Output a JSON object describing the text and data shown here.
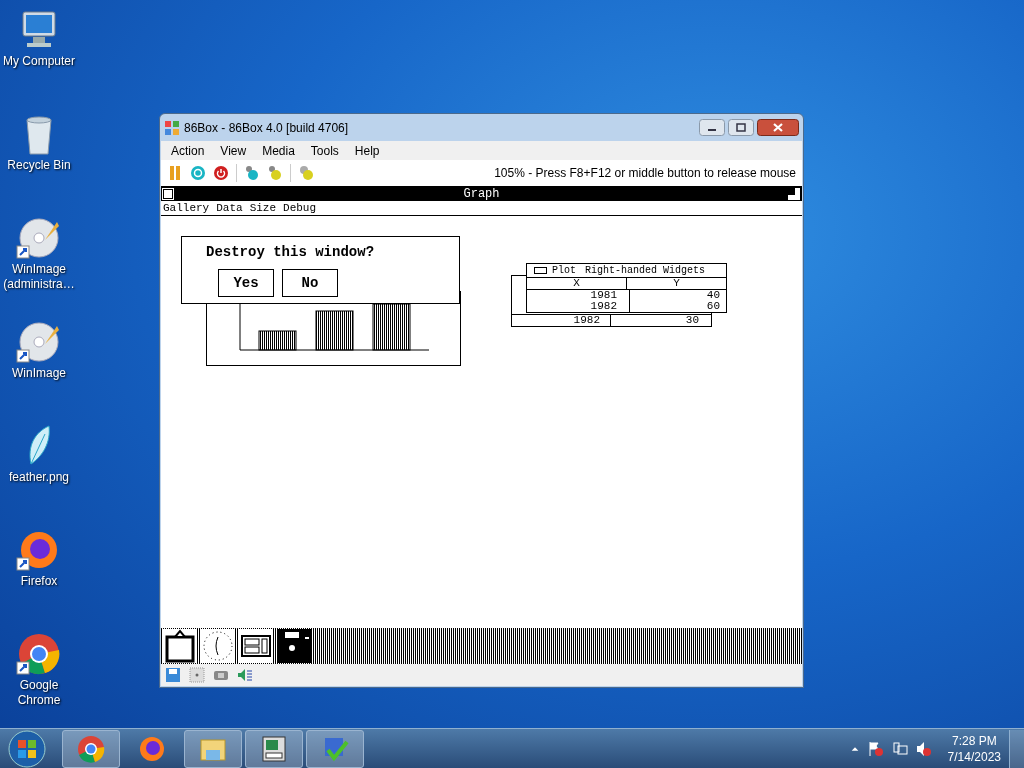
{
  "desktop_icons": [
    {
      "label": "My Computer",
      "kind": "computer"
    },
    {
      "label": "Recycle Bin",
      "kind": "recycle"
    },
    {
      "label": "WinImage (administra…",
      "kind": "disc-shortcut"
    },
    {
      "label": "WinImage",
      "kind": "disc-shortcut"
    },
    {
      "label": "feather.png",
      "kind": "feather"
    },
    {
      "label": "Firefox",
      "kind": "firefox"
    },
    {
      "label": "Google Chrome",
      "kind": "chrome"
    }
  ],
  "window": {
    "title": "86Box - 86Box 4.0 [build 4706]",
    "menu": [
      "Action",
      "View",
      "Media",
      "Tools",
      "Help"
    ],
    "status_text": "105% - Press F8+F12 or middle button to release mouse",
    "guest": {
      "title": "Graph",
      "menu": [
        "Gallery",
        "Data",
        "Size",
        "Debug"
      ],
      "dialog": {
        "question": "Destroy this window?",
        "buttons": [
          "Yes",
          "No"
        ]
      },
      "plot_window": {
        "title": "Plot",
        "subtitle": "Right-handed Widgets",
        "columns": [
          "X",
          "Y"
        ],
        "rows": [
          [
            "1981",
            "40"
          ],
          [
            "1982",
            "60"
          ]
        ]
      },
      "back_window": {
        "rows": [
          [
            "1982",
            "30"
          ]
        ]
      }
    }
  },
  "taskbar": {
    "apps": [
      {
        "kind": "chrome"
      },
      {
        "kind": "firefox"
      },
      {
        "kind": "explorer"
      },
      {
        "kind": "emulator"
      },
      {
        "kind": "installer"
      }
    ],
    "time": "7:28 PM",
    "date": "7/14/2023"
  }
}
